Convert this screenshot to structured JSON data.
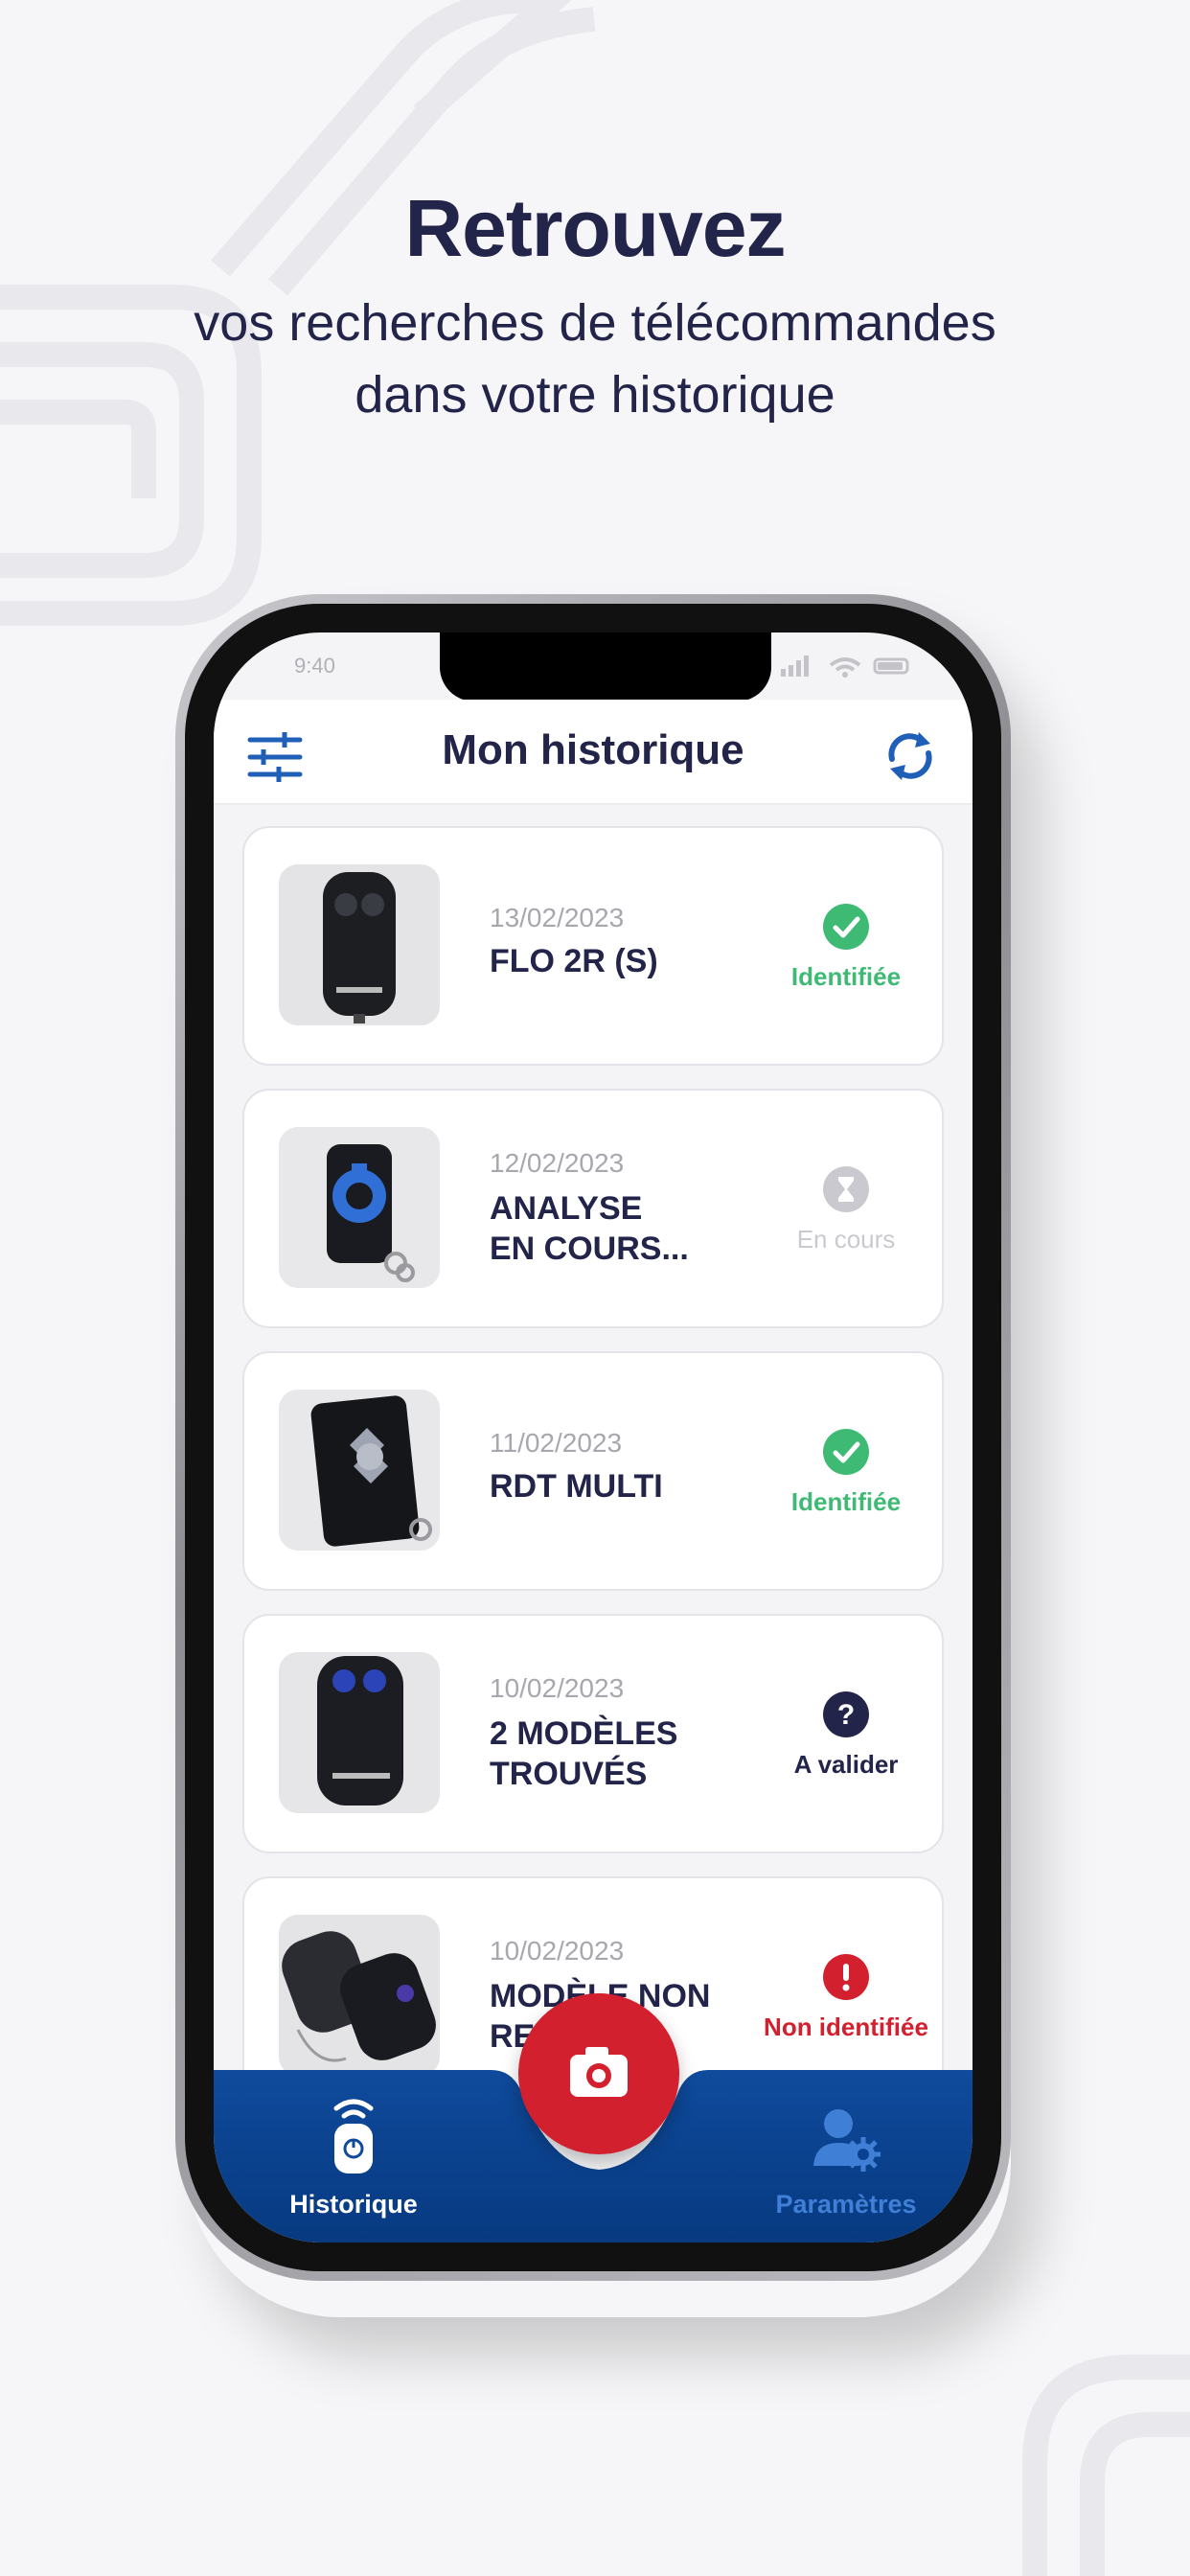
{
  "promo": {
    "headline": "Retrouvez",
    "subline_1": "vos recherches de télécommandes",
    "subline_2": "dans votre historique"
  },
  "status_bar": {
    "time": "9:40"
  },
  "app_bar": {
    "title": "Mon historique"
  },
  "items": [
    {
      "date": "13/02/2023",
      "name_1": "FLO 2R (S)",
      "name_2": "",
      "status": "Identifiée",
      "status_icon": "check-circle-icon",
      "status_color": "#3fba74"
    },
    {
      "date": "12/02/2023",
      "name_1": "ANALYSE",
      "name_2": "EN COURS...",
      "status": "En cours",
      "status_icon": "hourglass-icon",
      "status_color": "#c9c9cf"
    },
    {
      "date": "11/02/2023",
      "name_1": "RDT MULTI",
      "name_2": "",
      "status": "Identifiée",
      "status_icon": "check-circle-icon",
      "status_color": "#3fba74"
    },
    {
      "date": "10/02/2023",
      "name_1": "2 MODÈLES",
      "name_2": "TROUVÉS",
      "status": "A valider",
      "status_icon": "question-circle-icon",
      "status_color": "#23244a"
    },
    {
      "date": "10/02/2023",
      "name_1": "MODÈLE NON",
      "name_2": "RE",
      "status": "Non identifiée",
      "status_icon": "exclamation-circle-icon",
      "status_color": "#d3202f"
    }
  ],
  "bottom_nav": {
    "left_label": "Historique",
    "right_label": "Paramètres",
    "fab_icon": "camera-icon",
    "active_color": "#ffffff",
    "inactive_color": "#3f7fd6"
  },
  "colors": {
    "navy": "#23244a",
    "blue_gradient_top": "#0f4a9c",
    "blue_gradient_bottom": "#073a80",
    "accent_blue": "#1f5fb8",
    "fab_red": "#d3202f"
  }
}
